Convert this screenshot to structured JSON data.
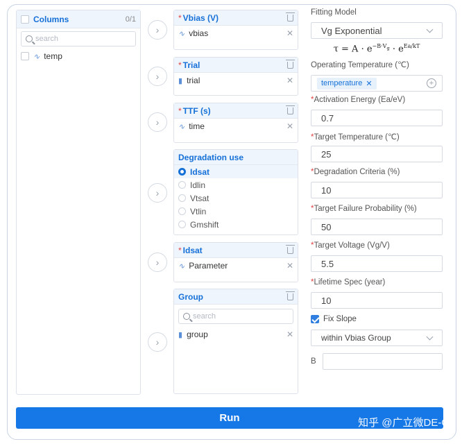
{
  "columns": {
    "title": "Columns",
    "count": "0/1",
    "search_placeholder": "search",
    "items": [
      {
        "label": "temp",
        "icon": "line-chart-icon"
      }
    ]
  },
  "drop_boxes": {
    "vbias": {
      "title": "Vbias (V)",
      "item": "vbias"
    },
    "trial": {
      "title": "Trial",
      "item": "trial"
    },
    "ttf": {
      "title": "TTF (s)",
      "item": "time"
    },
    "degradation": {
      "title": "Degradation use",
      "options": [
        "Idsat",
        "Idlin",
        "Vtsat",
        "Vtlin",
        "Gmshift"
      ],
      "selected": "Idsat"
    },
    "idsat": {
      "title": "Idsat",
      "item": "Parameter"
    },
    "group": {
      "title": "Group",
      "search_placeholder": "search",
      "item": "group"
    }
  },
  "form": {
    "fitting_model_label": "Fitting Model",
    "fitting_model_value": "Vg Exponential",
    "formula": {
      "lhs": "τ = A · e",
      "exp1": "−B·V",
      "exp1_sub": "g",
      "mid": " · e",
      "exp2": "Ea/kT"
    },
    "op_temp_label": "Operating Temperature (℃)",
    "op_temp_tag": "temperature",
    "activation_label": "Activation Energy (Ea/eV)",
    "activation_value": "0.7",
    "target_temp_label": "Target Temperature (℃)",
    "target_temp_value": "25",
    "criteria_label": "Degradation Criteria (%)",
    "criteria_value": "10",
    "failure_label": "Target Failure Probability (%)",
    "failure_value": "50",
    "voltage_label": "Target Voltage (Vg/V)",
    "voltage_value": "5.5",
    "lifetime_label": "Lifetime Spec (year)",
    "lifetime_value": "10",
    "fix_slope_label": "Fix Slope",
    "fix_slope_checked": true,
    "slope_scope_value": "within Vbias Group",
    "b_label": "B",
    "b_value": ""
  },
  "run_label": "Run",
  "watermark": "知乎 @广立微DE-G",
  "colors": {
    "accent": "#1677e6",
    "required": "#e04444",
    "header_bg": "#eef5fd"
  }
}
